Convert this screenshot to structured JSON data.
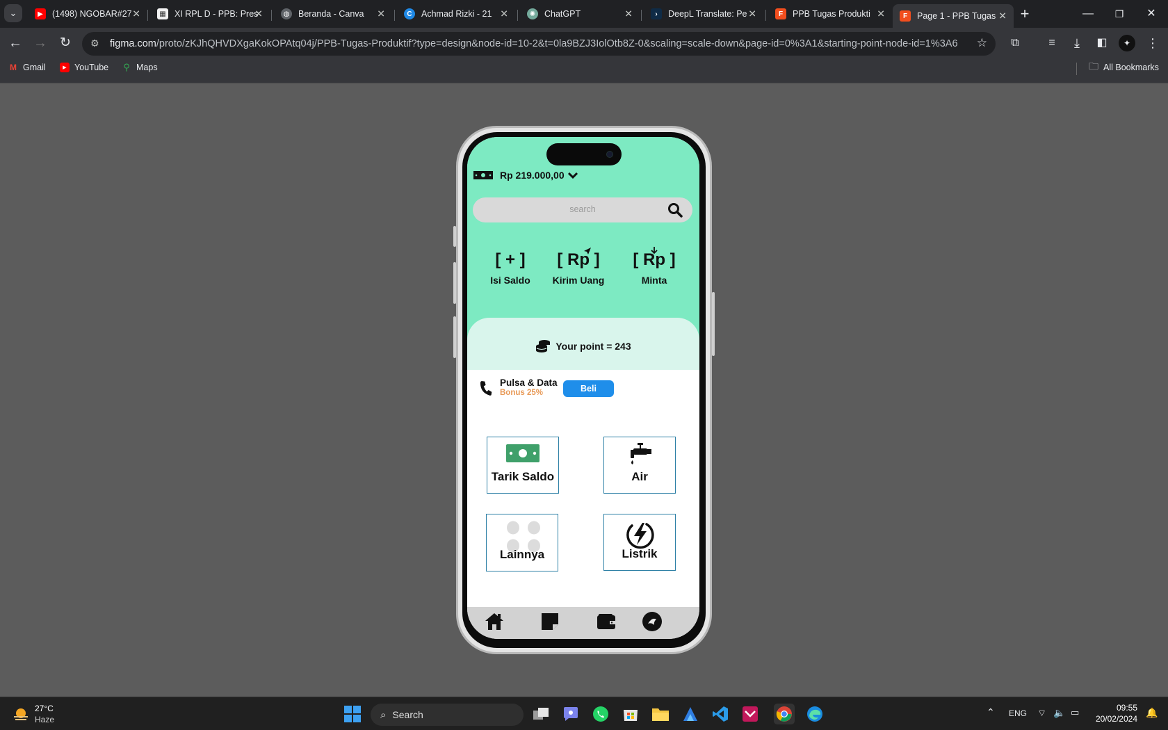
{
  "browser": {
    "tabs": [
      {
        "title": "(1498) NGOBAR#27",
        "icon": "youtube-icon",
        "color": "#ff0000"
      },
      {
        "title": "XI RPL D - PPB: Pres",
        "icon": "slides-icon",
        "color": "#f2f2f2"
      },
      {
        "title": "Beranda - Canva",
        "icon": "globe-icon",
        "color": "#9aa0a6"
      },
      {
        "title": "Achmad Rizki - 21",
        "icon": "canva-icon",
        "color": "#1e88e5"
      },
      {
        "title": "ChatGPT",
        "icon": "chatgpt-icon",
        "color": "#74aa9c"
      },
      {
        "title": "DeepL Translate: Pe",
        "icon": "deepl-icon",
        "color": "#0f2b46"
      },
      {
        "title": "PPB Tugas Produkti",
        "icon": "figma-icon",
        "color": "#f24e1e"
      },
      {
        "title": "Page 1 - PPB Tugas",
        "icon": "figma-icon",
        "color": "#f24e1e",
        "active": true
      }
    ],
    "url_host": "figma.com",
    "url_path": "/proto/zKJhQHVDXgaKokOPAtq04j/PPB-Tugas-Produktif?type=design&node-id=10-2&t=0la9BZJ3IolOtb8Z-0&scaling=scale-down&page-id=0%3A1&starting-point-node-id=1%3A6",
    "bookmarks": [
      {
        "label": "Gmail",
        "icon": "gmail-icon"
      },
      {
        "label": "YouTube",
        "icon": "youtube-icon"
      },
      {
        "label": "Maps",
        "icon": "maps-icon"
      }
    ],
    "all_bookmarks": "All Bookmarks"
  },
  "app": {
    "balance": "Rp 219.000,00",
    "search_placeholder": "search",
    "actions": [
      {
        "glyph": "[ + ]",
        "label": "Isi Saldo"
      },
      {
        "glyph": "[ Rp ]",
        "label": "Kirim Uang"
      },
      {
        "glyph": "[ Rp ]",
        "label": "Minta"
      }
    ],
    "points": "Your point = 243",
    "pulsa_title": "Pulsa & Data",
    "pulsa_bonus": "Bonus 25%",
    "buy_label": "Beli",
    "tiles": [
      {
        "label": "Tarik Saldo",
        "icon": "cash-icon"
      },
      {
        "label": "Air",
        "icon": "water-tap-icon"
      },
      {
        "label": "Lainnya",
        "icon": "more-dots-icon"
      },
      {
        "label": "Listrik",
        "icon": "lightning-icon"
      }
    ],
    "nav": [
      "home-icon",
      "notes-icon",
      "wallet-icon",
      "profile-avatar"
    ],
    "colors": {
      "header": "#7deac2",
      "point_band": "#d9f5ec",
      "buy_button": "#1f8eea",
      "bonus": "#e89a58",
      "tile_border": "#2c7fa5"
    }
  },
  "taskbar": {
    "weather_temp": "27°C",
    "weather_desc": "Haze",
    "search_label": "Search",
    "lang": "ENG",
    "time": "09:55",
    "date": "20/02/2024"
  }
}
